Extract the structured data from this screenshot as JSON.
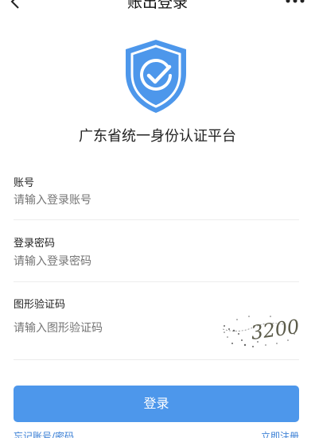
{
  "header": {
    "title": "账出登录",
    "back_icon": "chevron-left-icon",
    "more_icon": "more-icon"
  },
  "brand": {
    "logo_icon": "shield-check-icon",
    "logo_color": "#4d97eb",
    "platform_title": "广东省统一身份认证平台"
  },
  "form": {
    "account": {
      "label": "账号",
      "placeholder": "请输入登录账号"
    },
    "password": {
      "label": "登录密码",
      "placeholder": "请输入登录密码"
    },
    "captcha": {
      "label": "图形验证码",
      "placeholder": "请输入图形验证码",
      "image_text": "3200"
    }
  },
  "actions": {
    "login_label": "登录",
    "forgot_label": "忘记账号/密码",
    "register_label": "立即注册",
    "accent_color": "#4d97eb"
  }
}
